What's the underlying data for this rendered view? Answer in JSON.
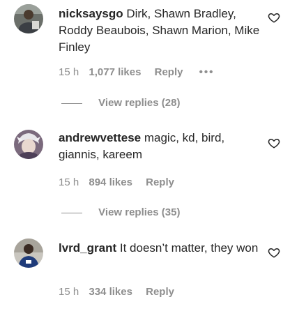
{
  "comments": [
    {
      "username": "nicksaysgo",
      "text": "Dirk, Shawn Bradley, Roddy Beaubois, Shawn Marion, Mike Finley",
      "time": "15 h",
      "likes": "1,077 likes",
      "reply_label": "Reply",
      "more_label": "•••",
      "view_replies": "View replies (28)"
    },
    {
      "username": "andrewvettese",
      "text": "magic, kd, bird, giannis, kareem",
      "time": "15 h",
      "likes": "894 likes",
      "reply_label": "Reply",
      "view_replies": "View replies (35)"
    },
    {
      "username": "lvrd_grant",
      "text": "It doesn’t matter, they won",
      "time": "15 h",
      "likes": "334 likes",
      "reply_label": "Reply"
    }
  ],
  "icons": {
    "heart": "heart-outline-icon",
    "more": "more-options-icon"
  },
  "colors": {
    "text": "#262626",
    "secondary": "#8e8e8e",
    "background": "#ffffff"
  }
}
